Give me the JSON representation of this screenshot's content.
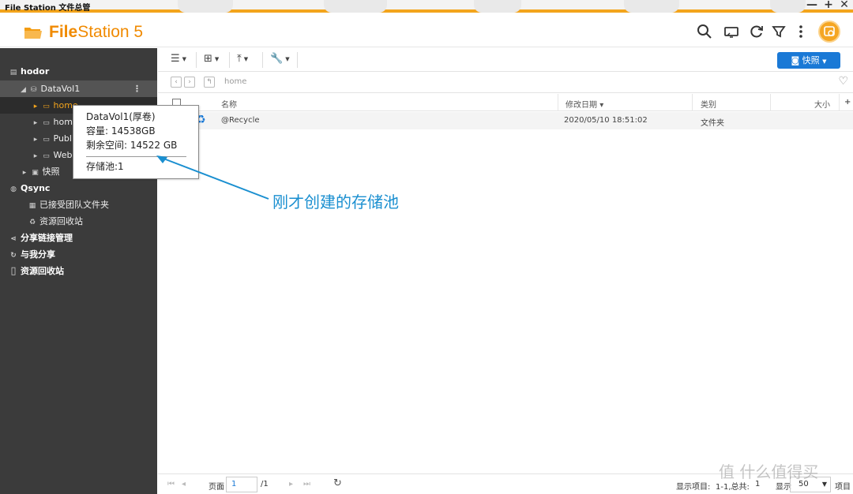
{
  "window": {
    "title": "File Station 文件总管",
    "controls": [
      "—",
      "+",
      "✕"
    ]
  },
  "app": {
    "name_bold": "File",
    "name_rest": "Station 5",
    "accent": "#f08a00"
  },
  "header": {
    "icons": [
      "search-icon",
      "media-cast-icon",
      "refresh-icon",
      "filter-icon",
      "more-icon",
      "user-avatar-icon"
    ]
  },
  "sidebar": {
    "server": "hodor",
    "items": [
      {
        "label": "DataVol1",
        "level": 1
      },
      {
        "label": "home",
        "level": 2
      },
      {
        "label": "home",
        "level": 2
      },
      {
        "label": "Publi",
        "level": 2
      },
      {
        "label": "Web",
        "level": 2
      },
      {
        "label": "快照",
        "level": 1
      }
    ],
    "qsync": "Qsync",
    "qsync_items": [
      "已接受团队文件夹",
      "资源回收站"
    ],
    "sections": [
      "分享链接管理",
      "与我分享",
      "资源回收站"
    ]
  },
  "toolbar": {
    "snapshot_label": "快照"
  },
  "pathbar": {
    "path": "home"
  },
  "table": {
    "columns": [
      "名称",
      "修改日期",
      "类别",
      "大小"
    ],
    "sort_indicator": "▾",
    "rows": [
      {
        "name": "@Recycle",
        "modified": "2020/05/10 18:51:02",
        "type": "文件夹",
        "size": ""
      }
    ]
  },
  "tooltip": {
    "line1": "DataVol1(厚卷)",
    "line2": "容量: 14538GB",
    "line3": "剩余空间: 14522 GB",
    "line4": "存储池:1"
  },
  "annotation": {
    "text": "刚才创建的存储池",
    "color": "#1a8fd0"
  },
  "footer": {
    "page_label": "页面",
    "page_value": "1",
    "page_total": "/1",
    "display_items_label": "显示项目:",
    "display_items_value": "1-1,总共:",
    "total_value": "1",
    "show_label": "显示",
    "per_page": "50",
    "items_label": "项目"
  },
  "watermark": "值 什么值得买"
}
